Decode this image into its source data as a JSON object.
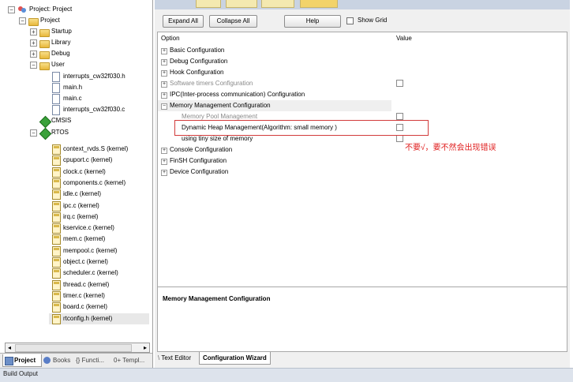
{
  "project_tree": {
    "root": "Project: Project",
    "project": "Project",
    "groups": [
      {
        "label": "Startup"
      },
      {
        "label": "Library"
      },
      {
        "label": "Debug"
      },
      {
        "label": "User"
      }
    ],
    "user_files": [
      "interrupts_cw32f030.h",
      "main.h",
      "main.c",
      "interrupts_cw32f030.c"
    ],
    "cmsis": "CMSIS",
    "rtos": "RTOS",
    "rtos_files": [
      "context_rvds.S (kernel)",
      "cpuport.c (kernel)",
      "clock.c (kernel)",
      "components.c (kernel)",
      "idle.c (kernel)",
      "ipc.c (kernel)",
      "irq.c (kernel)",
      "kservice.c (kernel)",
      "mem.c (kernel)",
      "mempool.c (kernel)",
      "object.c (kernel)",
      "scheduler.c (kernel)",
      "thread.c (kernel)",
      "timer.c (kernel)",
      "board.c (kernel)",
      "rtconfig.h (kernel)"
    ],
    "selected": "rtconfig.h (kernel)"
  },
  "left_tabs": [
    "Project",
    "Books",
    "{} Functi...",
    "0+ Templ..."
  ],
  "toolbar": {
    "expand_all": "Expand All",
    "collapse_all": "Collapse All",
    "help": "Help",
    "show_grid": "Show Grid"
  },
  "grid": {
    "col_option": "Option",
    "col_value": "Value",
    "rows": [
      {
        "label": "Basic Configuration",
        "expander": "+"
      },
      {
        "label": "Debug Configuration",
        "expander": "+"
      },
      {
        "label": "Hook Configuration",
        "expander": "+"
      },
      {
        "label": "Software timers Configuration",
        "expander": "+"
      },
      {
        "label": "IPC(Inter-process communication) Configuration",
        "expander": "+"
      },
      {
        "label": "Memory Management Configuration",
        "expander": "-"
      },
      {
        "label": "Memory Pool Management"
      },
      {
        "label": "Dynamic Heap Management(Algorithm: small memory )"
      },
      {
        "label": "using tiny size of memory"
      },
      {
        "label": "Console Configuration",
        "expander": "+"
      },
      {
        "label": "FinSH Configuration",
        "expander": "+"
      },
      {
        "label": "Device Configuration",
        "expander": "+"
      }
    ],
    "annotation": "不要√，要不然会出现错误"
  },
  "description": {
    "title": "Memory Management Configuration"
  },
  "bottom_tabs": {
    "text_editor": "Text Editor",
    "config_wizard": "Configuration Wizard"
  },
  "status": {
    "build_output": "Build Output"
  },
  "colors": {
    "annotation_red": "#e02020",
    "highlight_border": "#d23b3b",
    "status_bar": "#dde3ec"
  }
}
